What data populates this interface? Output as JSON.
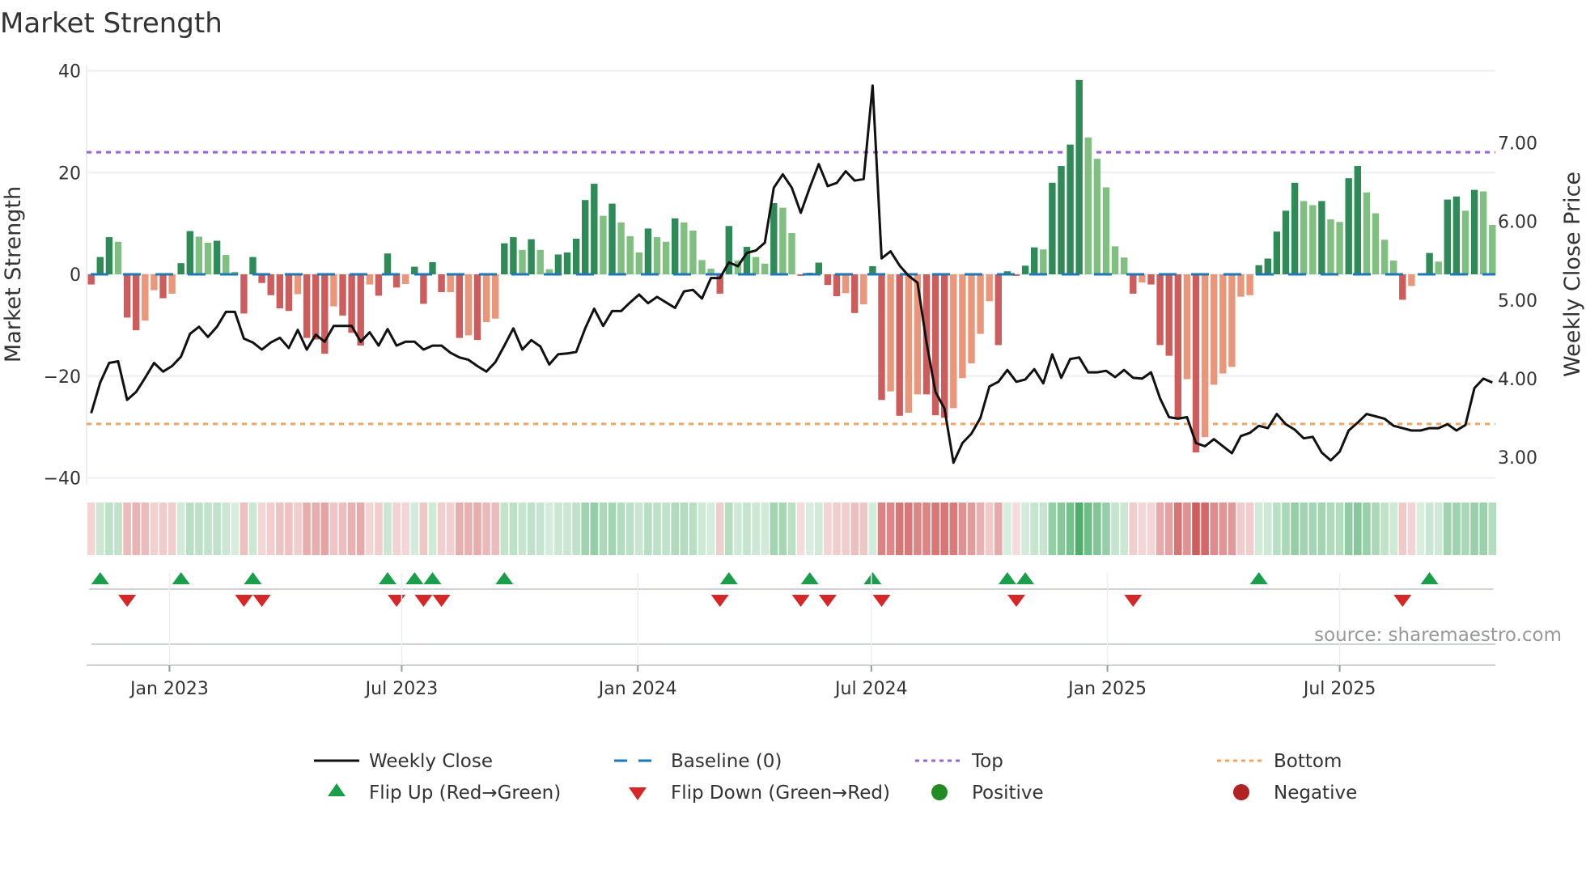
{
  "chart_data": {
    "type": "bar",
    "title": "Market Strength",
    "ylabel": "Market Strength",
    "y2label": "Weekly Close Price",
    "ylim": [
      -40,
      40
    ],
    "y2lim": [
      2.65,
      7.85
    ],
    "yticks": [
      "40",
      "20",
      "0",
      "−20",
      "−40"
    ],
    "ytick_values": [
      40,
      20,
      0,
      -20,
      -40
    ],
    "y2ticks": [
      "7.00",
      "6.00",
      "5.00",
      "4.00",
      "3.00"
    ],
    "y2tick_values": [
      7,
      6,
      5,
      4,
      3
    ],
    "xticks": [
      "Jan 2023",
      "Jul 2023",
      "Jan 2024",
      "Jul 2024",
      "Jan 2025",
      "Jul 2025"
    ],
    "xtick_dates": [
      "2023-01-01",
      "2023-07-01",
      "2024-01-01",
      "2024-07-01",
      "2025-01-01",
      "2025-07-01"
    ],
    "start_date": "2022-11-01",
    "frequency": "weekly",
    "top_level": 24,
    "bottom_level": -29.4,
    "values": [
      -2,
      3.4,
      7.3,
      6.4,
      -8.5,
      -11,
      -9.1,
      -3.1,
      -4.7,
      -3.8,
      2.2,
      8.5,
      7.4,
      6.2,
      6.6,
      3.8,
      0.5,
      -7.7,
      3.4,
      -1.7,
      -4.1,
      -6.7,
      -7.2,
      -3.9,
      -12.5,
      -12.8,
      -15.6,
      -6.3,
      -8.1,
      -11.5,
      -14,
      -2,
      -4.2,
      4.1,
      -2.6,
      -1.9,
      1.5,
      -5.8,
      2.4,
      -3.5,
      -3.5,
      -12.5,
      -12,
      -12.9,
      -9.4,
      -8.7,
      6.1,
      7.3,
      4.8,
      6.9,
      4.8,
      1,
      3.9,
      4.3,
      7,
      14.6,
      17.8,
      11.5,
      13.9,
      10.2,
      7.5,
      4.3,
      9,
      7.3,
      6.4,
      11,
      10.2,
      8.6,
      2.8,
      1.1,
      -3.8,
      9.5,
      2.7,
      5.4,
      3.4,
      2.1,
      14,
      13.1,
      8.1,
      -0.3,
      0.3,
      2.3,
      -2.1,
      -4.3,
      -3.7,
      -7.6,
      -5.9,
      1.6,
      -24.7,
      -23,
      -27.8,
      -27.2,
      -23.6,
      -23.6,
      -27.7,
      -28.2,
      -26.3,
      -20.4,
      -17.5,
      -11.7,
      -5.3,
      -13.9,
      0.6,
      -0.3,
      1.7,
      5.3,
      4.9,
      18,
      21.3,
      25.5,
      38.2,
      26.9,
      22.7,
      17.1,
      5.5,
      3.3,
      -3.8,
      -1.6,
      -2,
      -13.9,
      -16,
      -28.4,
      -20.6,
      -35,
      -32,
      -21.7,
      -19.5,
      -18.2,
      -4.4,
      -4.1,
      1.8,
      3.1,
      8.4,
      12.5,
      18,
      14.4,
      13.6,
      14.4,
      10.8,
      10.3,
      18.9,
      21.3,
      16.1,
      12,
      6.8,
      2.7,
      -5,
      -2.3,
      0,
      4.2,
      2.5,
      14.7,
      15.3,
      12.5,
      16.6,
      16.3,
      9.7
    ],
    "momentum": "DDDLDDLLDLDDLLDLLDDDDDDLDDDLDDDLDDDLDDDDLDLDLLDDLDLLDDDDDLDLLLDLLDLLLLDDLDLLDLLDDDDDLDLDDLDLLDDDLLLLLDDDDDLDDDDLLLLLDLDDDDLDLLLLLLDDDDDLLDLLDDLLLLDLDDLDDLDLL",
    "close": [
      3.56,
      3.95,
      4.2,
      4.22,
      3.73,
      3.83,
      4.01,
      4.2,
      4.09,
      4.16,
      4.28,
      4.57,
      4.66,
      4.53,
      4.66,
      4.85,
      4.85,
      4.51,
      4.46,
      4.37,
      4.46,
      4.52,
      4.39,
      4.62,
      4.37,
      4.56,
      4.47,
      4.67,
      4.67,
      4.67,
      4.47,
      4.59,
      4.42,
      4.63,
      4.42,
      4.47,
      4.47,
      4.37,
      4.42,
      4.42,
      4.33,
      4.27,
      4.24,
      4.16,
      4.09,
      4.21,
      4.42,
      4.64,
      4.37,
      4.49,
      4.41,
      4.18,
      4.31,
      4.32,
      4.34,
      4.64,
      4.89,
      4.67,
      4.86,
      4.86,
      4.97,
      5.07,
      4.96,
      5.04,
      4.97,
      4.9,
      5.11,
      5.13,
      5.02,
      5.28,
      5.28,
      5.48,
      5.43,
      5.6,
      5.63,
      5.73,
      6.43,
      6.6,
      6.43,
      6.11,
      6.43,
      6.73,
      6.45,
      6.49,
      6.64,
      6.52,
      6.54,
      7.73,
      5.53,
      5.62,
      5.44,
      5.31,
      5.22,
      4.46,
      3.83,
      3.62,
      2.93,
      3.18,
      3.3,
      3.5,
      3.9,
      3.96,
      4.11,
      3.96,
      3.99,
      4.12,
      3.94,
      4.31,
      4.01,
      4.25,
      4.27,
      4.08,
      4.08,
      4.1,
      4.02,
      4.11,
      4.01,
      4.0,
      4.08,
      3.75,
      3.51,
      3.49,
      3.51,
      3.18,
      3.14,
      3.23,
      3.14,
      3.05,
      3.27,
      3.31,
      3.4,
      3.37,
      3.55,
      3.42,
      3.35,
      3.24,
      3.26,
      3.06,
      2.96,
      3.07,
      3.34,
      3.44,
      3.55,
      3.52,
      3.49,
      3.4,
      3.37,
      3.34,
      3.34,
      3.37,
      3.37,
      3.42,
      3.34,
      3.41,
      3.88,
      4.0,
      3.95
    ],
    "flip_up_weeks": [
      2,
      11,
      19,
      34,
      37,
      39,
      47,
      72,
      81,
      88,
      103,
      105,
      131,
      150
    ],
    "flip_down_weeks": [
      5,
      18,
      20,
      35,
      38,
      40,
      71,
      80,
      83,
      89,
      104,
      117,
      147
    ],
    "legend": {
      "weekly_close": "Weekly Close",
      "baseline": "Baseline (0)",
      "top": "Top",
      "bottom": "Bottom",
      "flip_up": "Flip Up (Red→Green)",
      "flip_down": "Flip Down (Green→Red)",
      "positive": "Positive",
      "negative": "Negative"
    },
    "legend_placement": "bottom",
    "source": "source: sharemaestro.com",
    "colors": {
      "pos_strong": "#2e8b57",
      "pos_weak": "#7fbf7f",
      "neg_strong": "#cd5c5c",
      "neg_weak": "#e9967a",
      "baseline": "#1f77b4",
      "top": "#9b5fe0",
      "bottom": "#f4a460",
      "close": "#111111",
      "flip_up": "#1a9e4a",
      "flip_down": "#d62728",
      "positive": "#228b22",
      "negative": "#b22222"
    }
  }
}
